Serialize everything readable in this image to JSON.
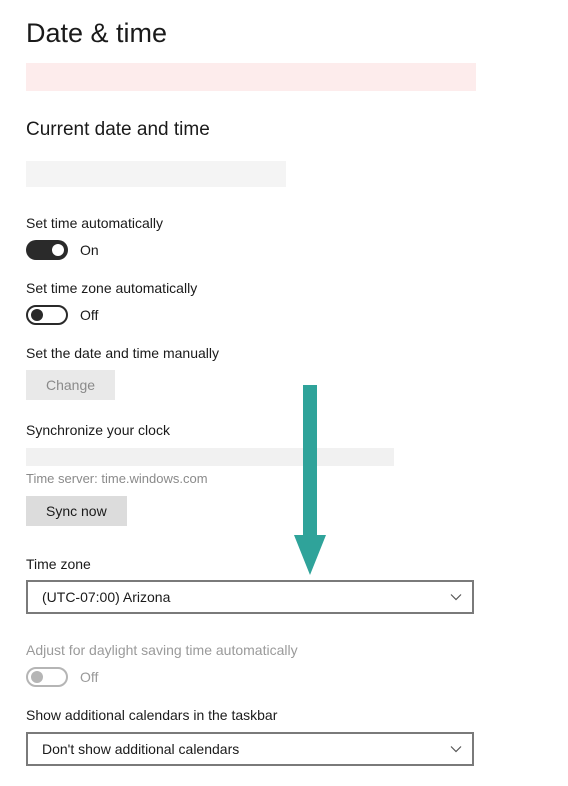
{
  "page": {
    "title": "Date & time",
    "subtitle": "Current date and time"
  },
  "settings": {
    "set_time_auto": {
      "label": "Set time automatically",
      "state": "On",
      "on": true
    },
    "set_tz_auto": {
      "label": "Set time zone automatically",
      "state": "Off",
      "on": false
    },
    "set_manual": {
      "label": "Set the date and time manually",
      "button": "Change"
    }
  },
  "sync": {
    "heading": "Synchronize your clock",
    "server_label": "Time server: time.windows.com",
    "button": "Sync now"
  },
  "timezone": {
    "label": "Time zone",
    "selected": "(UTC-07:00) Arizona"
  },
  "dst": {
    "label": "Adjust for daylight saving time automatically",
    "state": "Off"
  },
  "calendars": {
    "label": "Show additional calendars in the taskbar",
    "selected": "Don't show additional calendars"
  }
}
